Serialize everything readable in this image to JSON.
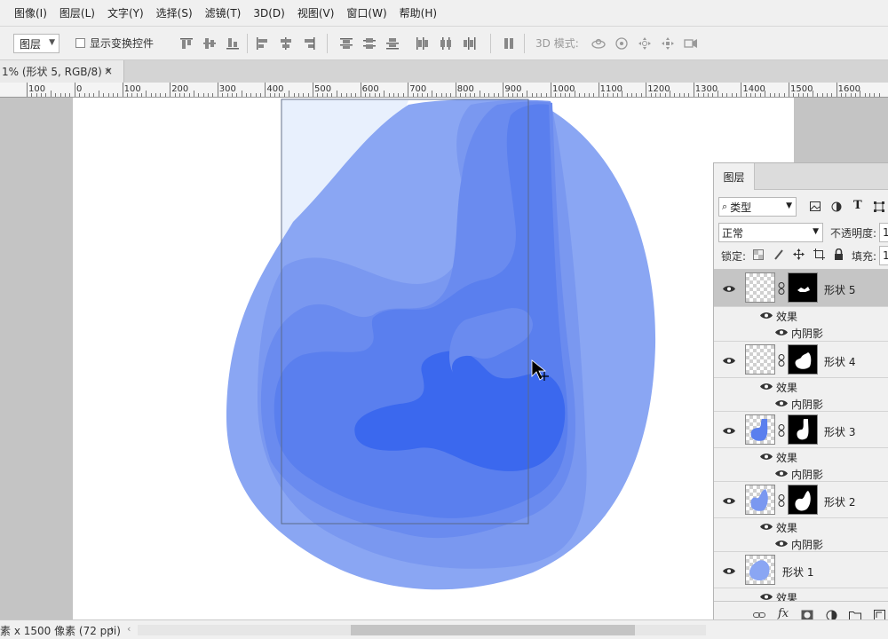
{
  "menu": [
    "图像(I)",
    "图层(L)",
    "文字(Y)",
    "选择(S)",
    "滤镜(T)",
    "3D(D)",
    "视图(V)",
    "窗口(W)",
    "帮助(H)"
  ],
  "options": {
    "layer_select": "图层",
    "show_transform_label": "显示变换控件",
    "mode3d_label": "3D 模式:"
  },
  "doc_tab": {
    "title": "1% (形状 5, RGB/8) *",
    "close": "×"
  },
  "ruler": {
    "labels": [
      "100",
      "0",
      "100",
      "200",
      "300",
      "400",
      "500",
      "600",
      "700",
      "800",
      "900",
      "1000",
      "1100",
      "1200",
      "1300",
      "1400",
      "1500",
      "1600"
    ]
  },
  "layers_panel": {
    "tab": "图层",
    "filter_kind": "类型",
    "blend_mode": "正常",
    "opacity_label": "不透明度:",
    "opacity_value": "1",
    "lock_label": "锁定:",
    "fill_label": "填充:",
    "fill_value": "1",
    "effects_label": "效果",
    "effect_name": "内阴影",
    "layers": [
      {
        "name": "形状 5",
        "selected": true
      },
      {
        "name": "形状 4",
        "selected": false
      },
      {
        "name": "形状 3",
        "selected": false
      },
      {
        "name": "形状 2",
        "selected": false
      },
      {
        "name": "形状 1",
        "selected": false
      }
    ]
  },
  "status": {
    "doc_info": "素 x 1500 像素 (72 ppi)"
  },
  "colors": {
    "shape1": "#8aa6f3",
    "shape2": "#7a98f0",
    "shape3": "#6a8bef",
    "shape4": "#5a7fee",
    "shape5": "#3b68ee",
    "sky": "#e8f0fd"
  }
}
